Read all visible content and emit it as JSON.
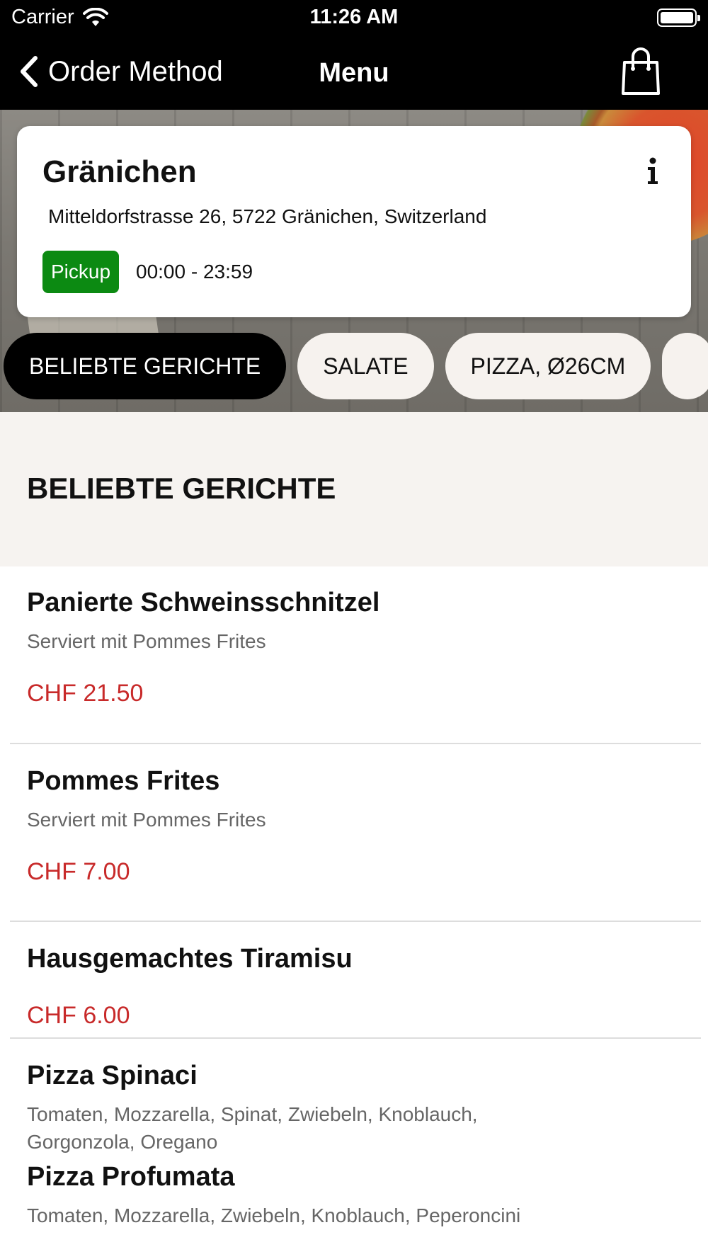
{
  "status_bar": {
    "carrier": "Carrier",
    "time": "11:26 AM"
  },
  "nav": {
    "back_label": "Order Method",
    "title": "Menu"
  },
  "store": {
    "name": "Gränichen",
    "address": "Mitteldorfstrasse 26, 5722 Gränichen, Switzerland",
    "method": "Pickup",
    "hours": "00:00 - 23:59",
    "method_color": "#0c8a12"
  },
  "categories": [
    {
      "label": "BELIEBTE GERICHTE",
      "active": true
    },
    {
      "label": "SALATE",
      "active": false
    },
    {
      "label": "PIZZA,  Ø26CM",
      "active": false
    }
  ],
  "section": {
    "title": "BELIEBTE GERICHTE"
  },
  "items": [
    {
      "name": "Panierte Schweinsschnitzel",
      "description": "Serviert mit Pommes Frites",
      "price": "CHF 21.50"
    },
    {
      "name": "Pommes Frites",
      "description": "Serviert mit Pommes Frites",
      "price": "CHF 7.00"
    },
    {
      "name": "Hausgemachtes Tiramisu",
      "description": "",
      "price": "CHF 6.00"
    },
    {
      "name": "Pizza Spinaci",
      "description": "Tomaten, Mozzarella, Spinat, Zwiebeln, Knoblauch, Gorgonzola, Oregano",
      "price": ""
    },
    {
      "name": "Pizza Profumata",
      "description": "Tomaten, Mozzarella, Zwiebeln, Knoblauch, Peperoncini",
      "price": ""
    }
  ],
  "colors": {
    "price": "#c82a2a",
    "nav_background": "#000000",
    "section_background": "#f6f3f0"
  },
  "icons": [
    "wifi-icon",
    "battery-icon",
    "back-chevron-icon",
    "shopping-bag-icon",
    "info-icon"
  ]
}
